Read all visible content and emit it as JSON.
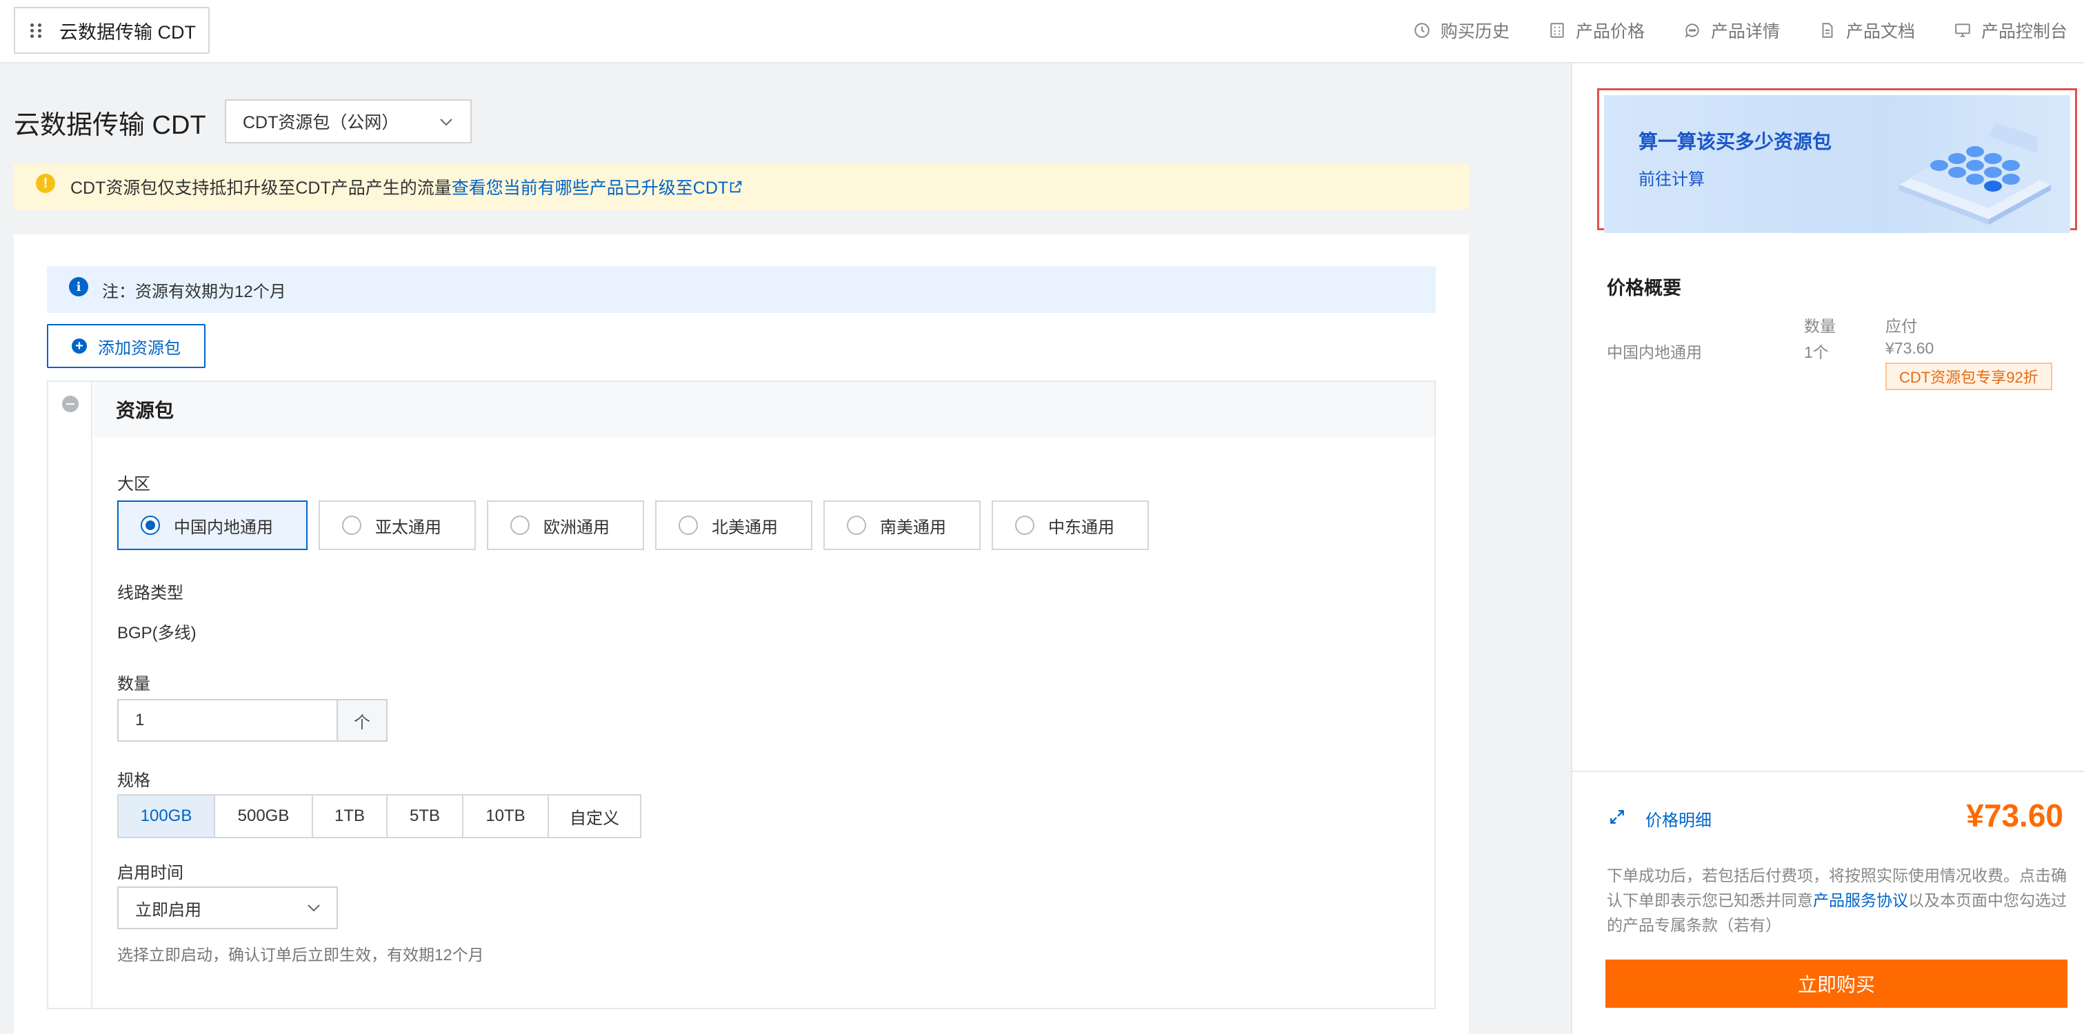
{
  "topbar": {
    "product_name": "云数据传输 CDT",
    "links": [
      {
        "label": "购买历史",
        "icon": "clock-icon"
      },
      {
        "label": "产品价格",
        "icon": "calculator-icon"
      },
      {
        "label": "产品详情",
        "icon": "chat-icon"
      },
      {
        "label": "产品文档",
        "icon": "document-icon"
      },
      {
        "label": "产品控制台",
        "icon": "monitor-icon"
      }
    ]
  },
  "main": {
    "title": "云数据传输 CDT",
    "type_select": "CDT资源包（公网）",
    "notice_text": "CDT资源包仅支持抵扣升级至CDT产品产生的流量",
    "notice_link": "查看您当前有哪些产品已升级至CDT",
    "info_text": "注：资源有效期为12个月",
    "add_button": "添加资源包",
    "package": {
      "title": "资源包",
      "region_label": "大区",
      "regions": [
        "中国内地通用",
        "亚太通用",
        "欧洲通用",
        "北美通用",
        "南美通用",
        "中东通用"
      ],
      "selected_region": "中国内地通用",
      "line_label": "线路类型",
      "line_value": "BGP(多线)",
      "quantity_label": "数量",
      "quantity_value": "1",
      "quantity_unit": "个",
      "spec_label": "规格",
      "specs": [
        "100GB",
        "500GB",
        "1TB",
        "5TB",
        "10TB",
        "自定义"
      ],
      "selected_spec": "100GB",
      "start_label": "启用时间",
      "start_value": "立即启用",
      "start_hint": "选择立即启动，确认订单后立即生效，有效期12个月"
    }
  },
  "sidebar": {
    "banner_title": "算一算该买多少资源包",
    "banner_link": "前往计算",
    "summary_title": "价格概要",
    "col_qty": "数量",
    "col_pay": "应付",
    "row_name": "中国内地通用",
    "row_qty": "1个",
    "row_price": "¥73.60",
    "discount": "CDT资源包专享92折",
    "detail_link": "价格明细",
    "total": "¥73.60",
    "terms_before": "下单成功后，若包括后付费项，将按照实际使用情况收费。点击确认下单即表示您已知悉并同意",
    "terms_link": "产品服务协议",
    "terms_after": "以及本页面中您勾选过的产品专属条款（若有）",
    "buy_button": "立即购买",
    "colors": {
      "accent": "#0064c8",
      "buy": "#ff6a00",
      "banner_outline": "#e05050"
    }
  }
}
